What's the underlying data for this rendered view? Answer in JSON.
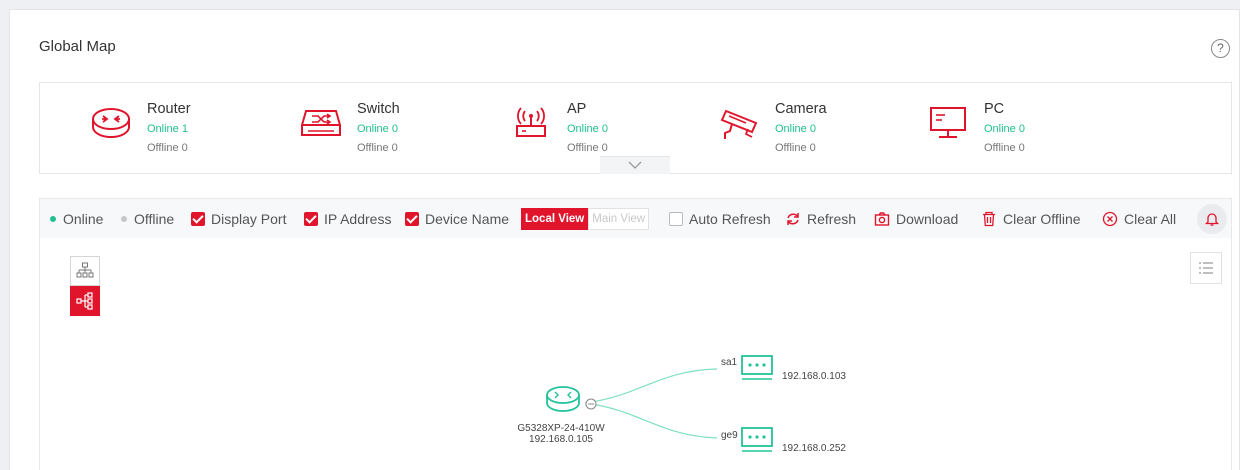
{
  "header": {
    "title": "Global Map",
    "help_glyph": "?"
  },
  "devices": [
    {
      "name": "Router",
      "online": "Online 1",
      "offline": "Offline 0",
      "icon": "router-icon"
    },
    {
      "name": "Switch",
      "online": "Online 0",
      "offline": "Offline 0",
      "icon": "switch-icon"
    },
    {
      "name": "AP",
      "online": "Online 0",
      "offline": "Offline 0",
      "icon": "ap-icon"
    },
    {
      "name": "Camera",
      "online": "Online 0",
      "offline": "Offline 0",
      "icon": "camera-icon"
    },
    {
      "name": "PC",
      "online": "Online 0",
      "offline": "Offline 0",
      "icon": "pc-icon"
    }
  ],
  "toolbar": {
    "legend_online": "Online",
    "legend_offline": "Offline",
    "display_port": {
      "label": "Display Port",
      "checked": true
    },
    "ip_address": {
      "label": "IP Address",
      "checked": true
    },
    "device_name": {
      "label": "Device Name",
      "checked": true
    },
    "local_view": "Local View",
    "main_view": "Main View",
    "auto_refresh": {
      "label": "Auto Refresh",
      "checked": false
    },
    "refresh": "Refresh",
    "download": "Download",
    "clear_offline": "Clear Offline",
    "clear_all": "Clear All"
  },
  "topology": {
    "root": {
      "name": "G5328XP-24-410W",
      "ip": "192.168.0.105"
    },
    "children": [
      {
        "port": "sa1",
        "ip": "192.168.0.103"
      },
      {
        "port": "ge9",
        "ip": "192.168.0.252"
      }
    ]
  },
  "colors": {
    "accent": "#e0152c",
    "online": "#1fbf8f",
    "offline": "#c7c7c7",
    "device_stroke": "#22c39a"
  }
}
